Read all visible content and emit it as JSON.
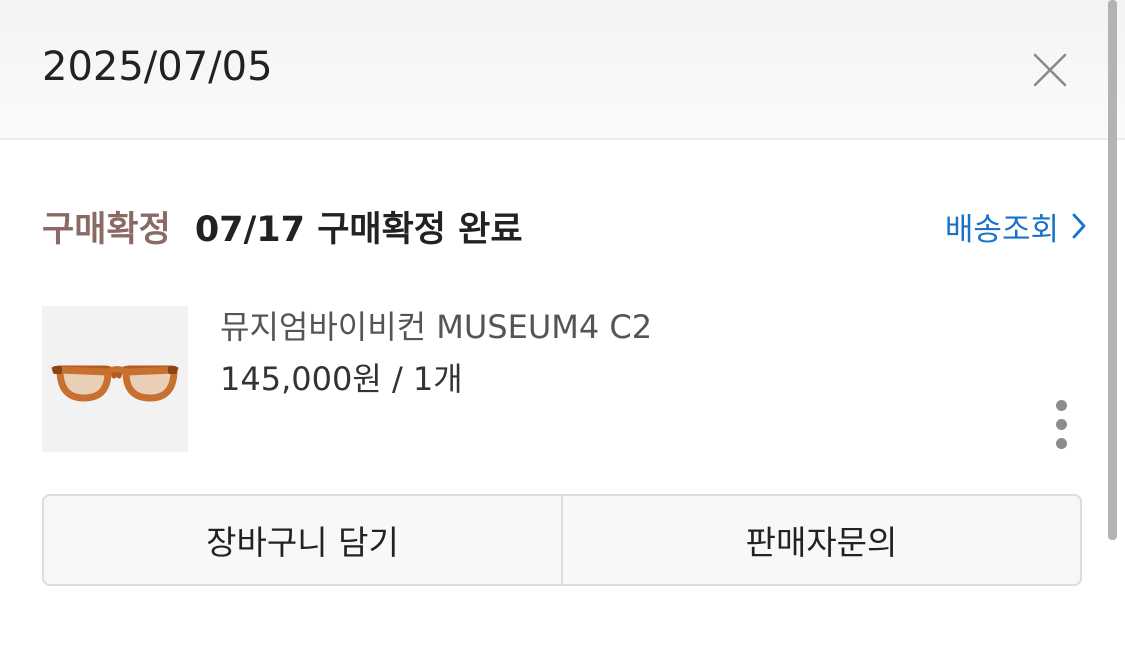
{
  "header": {
    "date": "2025/07/05",
    "close_icon": "close-icon"
  },
  "order": {
    "status_label": "구매확정",
    "status_detail": "07/17 구매확정 완료",
    "track_link": "배송조회",
    "track_icon": "chevron-right-icon"
  },
  "product": {
    "image_icon": "glasses-icon",
    "name": "뮤지엄바이비컨 MUSEUM4 C2",
    "price_qty": "145,000원 / 1개",
    "more_icon": "more-vertical-icon"
  },
  "actions": {
    "cart_label": "장바구니 담기",
    "inquiry_label": "판매자문의"
  },
  "colors": {
    "status_accent": "#8a6a64",
    "link": "#1a73c9",
    "frame": "#c8702f"
  }
}
